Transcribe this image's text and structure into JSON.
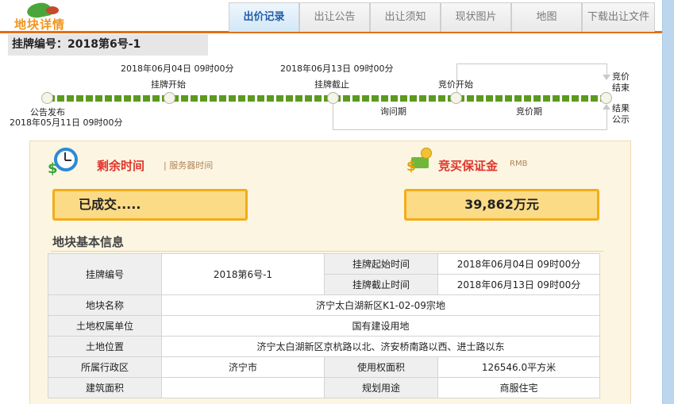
{
  "header": {
    "logo_text": "地块详情",
    "tabs": [
      {
        "label": "出价记录",
        "active": true
      },
      {
        "label": "出让公告",
        "active": false
      },
      {
        "label": "出让须知",
        "active": false
      },
      {
        "label": "现状图片",
        "active": false
      },
      {
        "label": "地图",
        "active": false
      },
      {
        "label": "下载出让文件",
        "active": false
      }
    ]
  },
  "lot": {
    "label_line": "挂牌编号：2018第6号-1"
  },
  "timeline": {
    "announce": {
      "label": "公告发布",
      "time": "2018年05月11日 09时00分"
    },
    "listing_start": {
      "label": "挂牌开始",
      "time": "2018年06月04日 09时00分"
    },
    "listing_end": {
      "label": "挂牌截止",
      "time": "2018年06月13日 09时00分"
    },
    "bidding_start": {
      "label": "竞价开始"
    },
    "bidding_end": {
      "label": "竞价结束"
    },
    "result": {
      "label": "结果公示"
    },
    "inquiry_period": "询问期",
    "bidding_period": "竞价期"
  },
  "auction": {
    "remaining_title": "剩余时间",
    "server_time_label": "| 服务器时间",
    "deposit_title": "竞买保证金",
    "currency": "RMB",
    "status": "已成交.....",
    "deposit_value": "39,862万元"
  },
  "basic_info": {
    "title": "地块基本信息",
    "rows": {
      "listing_no_label": "挂牌编号",
      "listing_no": "2018第6号-1",
      "start_label": "挂牌起始时间",
      "start": "2018年06月04日 09时00分",
      "end_label": "挂牌截止时间",
      "end": "2018年06月13日 09时00分",
      "name_label": "地块名称",
      "name": "济宁太白湖新区K1-02-09宗地",
      "owner_label": "土地权属单位",
      "owner": "国有建设用地",
      "location_label": "土地位置",
      "location": "济宁太白湖新区京杭路以北、济安桥南路以西、进士路以东",
      "district_label": "所属行政区",
      "district": "济宁市",
      "area_label": "使用权面积",
      "area": "126546.0平方米",
      "build_area_label": "建筑面积",
      "build_area": "",
      "use_label": "规划用途",
      "use": "商服住宅"
    }
  },
  "colors": {
    "accent": "#e46f14",
    "progress": "#5b9a1f",
    "highlight_box": "#fbdb86",
    "title_red": "#e0352b"
  }
}
